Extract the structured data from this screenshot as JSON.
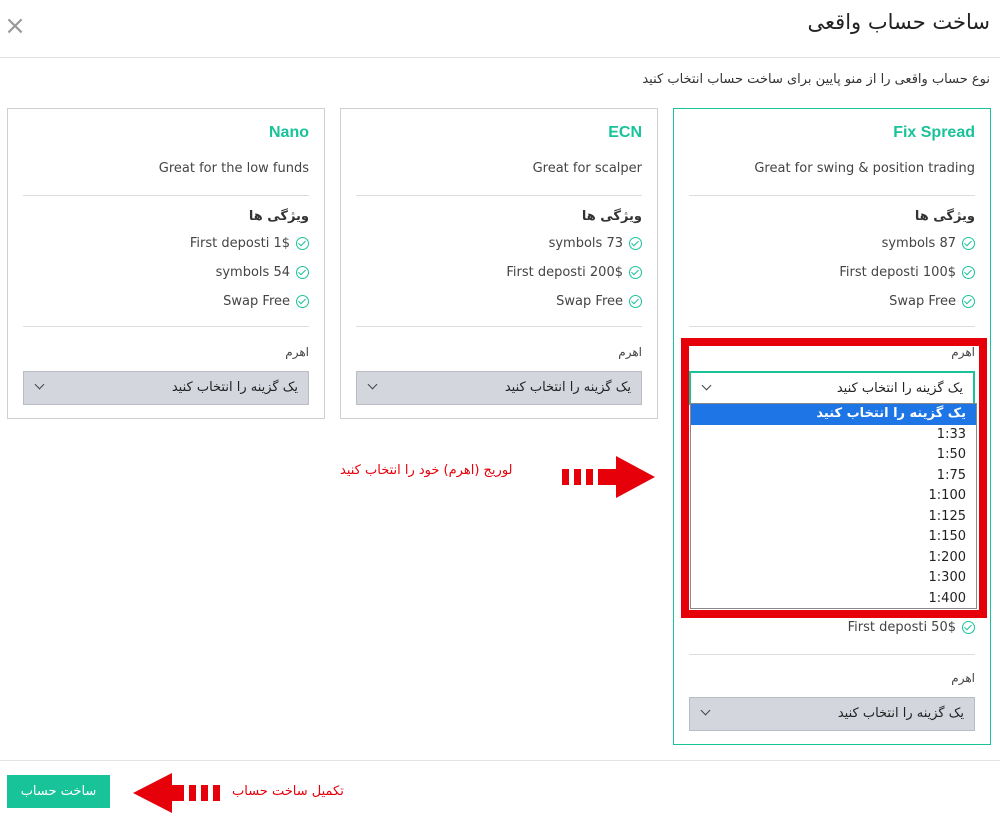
{
  "modal": {
    "title": "ساخت حساب واقعی",
    "subtitle": "نوع حساب واقعی را از منو پایین برای ساخت حساب انتخاب کنید",
    "close_icon": "close-icon"
  },
  "features_title": "ویژگی ها",
  "leverage_label": "اهرم",
  "select_placeholder": "یک گزینه را انتخاب کنید",
  "cards": [
    {
      "name": "Fix Spread",
      "desc": "Great for swing & position trading",
      "features": [
        "symbols 87",
        "First deposti 100$",
        "Swap Free"
      ],
      "hidden_feature": "First deposti 50$"
    },
    {
      "name": "ECN",
      "desc": "Great for scalper",
      "features": [
        "symbols 73",
        "First deposti 200$",
        "Swap Free"
      ]
    },
    {
      "name": "Nano",
      "desc": "Great for the low funds",
      "features": [
        "First deposti 1$",
        "symbols 54",
        "Swap Free"
      ]
    }
  ],
  "dropdown_options": [
    "یک گزینه را انتخاب کنید",
    "1:33",
    "1:50",
    "1:75",
    "1:100",
    "1:125",
    "1:150",
    "1:200",
    "1:300",
    "1:400"
  ],
  "annotations": {
    "leverage_hint": "لوریج (اهرم) خود را انتخاب کنید",
    "finish_hint": "تکمیل ساخت حساب"
  },
  "submit_label": "ساخت حساب",
  "colors": {
    "accent": "#19c39a",
    "highlight_red": "#e6000a",
    "option_selected": "#1e75e6"
  }
}
